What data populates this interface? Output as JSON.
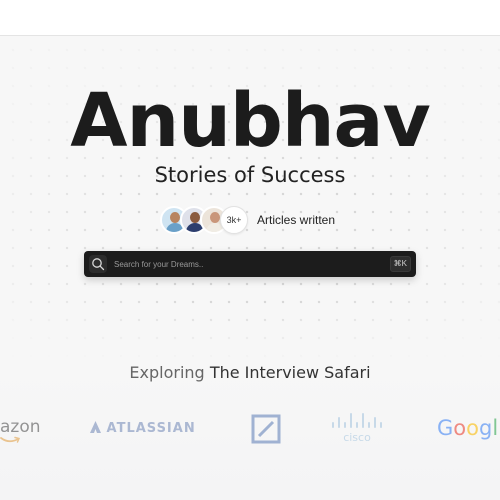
{
  "hero": {
    "title": "Anubhav",
    "subtitle": "Stories of Success",
    "articles_count": "3k+",
    "articles_label": "Articles written",
    "avatars": [
      {
        "name": "avatar-1",
        "bg": "#cfe4f2",
        "skin": "#b88460",
        "shirt": "#6aa0c8"
      },
      {
        "name": "avatar-2",
        "bg": "#dfe1ea",
        "skin": "#8a5a3e",
        "shirt": "#2c3e6e"
      },
      {
        "name": "avatar-3",
        "bg": "#ece4da",
        "skin": "#c9967a",
        "shirt": "#f0ece4"
      }
    ]
  },
  "search": {
    "placeholder": "Search for your Dreams..",
    "shortcut": "⌘K"
  },
  "companies": {
    "heading_prefix": "Exploring",
    "heading_emphasis": "The Interview Safari",
    "logos": [
      {
        "name": "amazon",
        "text": "azon"
      },
      {
        "name": "atlassian",
        "text": "ATLASSIAN"
      },
      {
        "name": "deutsche-bank",
        "text": ""
      },
      {
        "name": "cisco",
        "text": "cisco"
      },
      {
        "name": "google",
        "text": "Googl"
      }
    ]
  },
  "colors": {
    "background": "#f7f7f7",
    "search_bg": "#1c1c1c",
    "atlassian_blue": "#6f86b5",
    "google_blue": "#4285f4",
    "google_red": "#ea4335",
    "google_yellow": "#fbbc05",
    "google_green": "#34a853"
  }
}
